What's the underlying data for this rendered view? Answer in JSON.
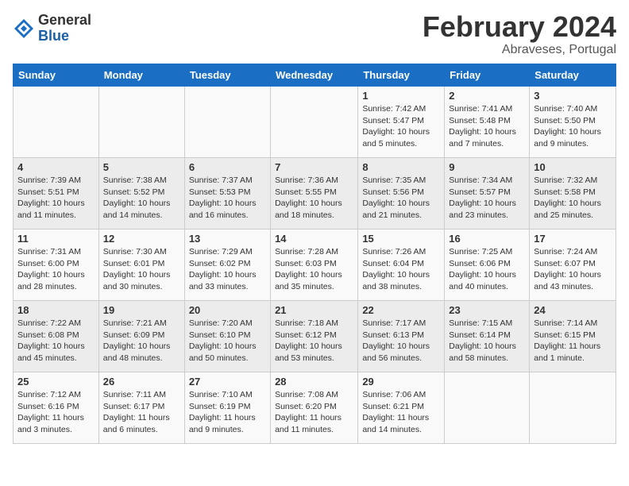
{
  "header": {
    "logo_general": "General",
    "logo_blue": "Blue",
    "month_title": "February 2024",
    "location": "Abraveses, Portugal"
  },
  "days_of_week": [
    "Sunday",
    "Monday",
    "Tuesday",
    "Wednesday",
    "Thursday",
    "Friday",
    "Saturday"
  ],
  "weeks": [
    [
      {
        "day": "",
        "info": ""
      },
      {
        "day": "",
        "info": ""
      },
      {
        "day": "",
        "info": ""
      },
      {
        "day": "",
        "info": ""
      },
      {
        "day": "1",
        "info": "Sunrise: 7:42 AM\nSunset: 5:47 PM\nDaylight: 10 hours\nand 5 minutes."
      },
      {
        "day": "2",
        "info": "Sunrise: 7:41 AM\nSunset: 5:48 PM\nDaylight: 10 hours\nand 7 minutes."
      },
      {
        "day": "3",
        "info": "Sunrise: 7:40 AM\nSunset: 5:50 PM\nDaylight: 10 hours\nand 9 minutes."
      }
    ],
    [
      {
        "day": "4",
        "info": "Sunrise: 7:39 AM\nSunset: 5:51 PM\nDaylight: 10 hours\nand 11 minutes."
      },
      {
        "day": "5",
        "info": "Sunrise: 7:38 AM\nSunset: 5:52 PM\nDaylight: 10 hours\nand 14 minutes."
      },
      {
        "day": "6",
        "info": "Sunrise: 7:37 AM\nSunset: 5:53 PM\nDaylight: 10 hours\nand 16 minutes."
      },
      {
        "day": "7",
        "info": "Sunrise: 7:36 AM\nSunset: 5:55 PM\nDaylight: 10 hours\nand 18 minutes."
      },
      {
        "day": "8",
        "info": "Sunrise: 7:35 AM\nSunset: 5:56 PM\nDaylight: 10 hours\nand 21 minutes."
      },
      {
        "day": "9",
        "info": "Sunrise: 7:34 AM\nSunset: 5:57 PM\nDaylight: 10 hours\nand 23 minutes."
      },
      {
        "day": "10",
        "info": "Sunrise: 7:32 AM\nSunset: 5:58 PM\nDaylight: 10 hours\nand 25 minutes."
      }
    ],
    [
      {
        "day": "11",
        "info": "Sunrise: 7:31 AM\nSunset: 6:00 PM\nDaylight: 10 hours\nand 28 minutes."
      },
      {
        "day": "12",
        "info": "Sunrise: 7:30 AM\nSunset: 6:01 PM\nDaylight: 10 hours\nand 30 minutes."
      },
      {
        "day": "13",
        "info": "Sunrise: 7:29 AM\nSunset: 6:02 PM\nDaylight: 10 hours\nand 33 minutes."
      },
      {
        "day": "14",
        "info": "Sunrise: 7:28 AM\nSunset: 6:03 PM\nDaylight: 10 hours\nand 35 minutes."
      },
      {
        "day": "15",
        "info": "Sunrise: 7:26 AM\nSunset: 6:04 PM\nDaylight: 10 hours\nand 38 minutes."
      },
      {
        "day": "16",
        "info": "Sunrise: 7:25 AM\nSunset: 6:06 PM\nDaylight: 10 hours\nand 40 minutes."
      },
      {
        "day": "17",
        "info": "Sunrise: 7:24 AM\nSunset: 6:07 PM\nDaylight: 10 hours\nand 43 minutes."
      }
    ],
    [
      {
        "day": "18",
        "info": "Sunrise: 7:22 AM\nSunset: 6:08 PM\nDaylight: 10 hours\nand 45 minutes."
      },
      {
        "day": "19",
        "info": "Sunrise: 7:21 AM\nSunset: 6:09 PM\nDaylight: 10 hours\nand 48 minutes."
      },
      {
        "day": "20",
        "info": "Sunrise: 7:20 AM\nSunset: 6:10 PM\nDaylight: 10 hours\nand 50 minutes."
      },
      {
        "day": "21",
        "info": "Sunrise: 7:18 AM\nSunset: 6:12 PM\nDaylight: 10 hours\nand 53 minutes."
      },
      {
        "day": "22",
        "info": "Sunrise: 7:17 AM\nSunset: 6:13 PM\nDaylight: 10 hours\nand 56 minutes."
      },
      {
        "day": "23",
        "info": "Sunrise: 7:15 AM\nSunset: 6:14 PM\nDaylight: 10 hours\nand 58 minutes."
      },
      {
        "day": "24",
        "info": "Sunrise: 7:14 AM\nSunset: 6:15 PM\nDaylight: 11 hours\nand 1 minute."
      }
    ],
    [
      {
        "day": "25",
        "info": "Sunrise: 7:12 AM\nSunset: 6:16 PM\nDaylight: 11 hours\nand 3 minutes."
      },
      {
        "day": "26",
        "info": "Sunrise: 7:11 AM\nSunset: 6:17 PM\nDaylight: 11 hours\nand 6 minutes."
      },
      {
        "day": "27",
        "info": "Sunrise: 7:10 AM\nSunset: 6:19 PM\nDaylight: 11 hours\nand 9 minutes."
      },
      {
        "day": "28",
        "info": "Sunrise: 7:08 AM\nSunset: 6:20 PM\nDaylight: 11 hours\nand 11 minutes."
      },
      {
        "day": "29",
        "info": "Sunrise: 7:06 AM\nSunset: 6:21 PM\nDaylight: 11 hours\nand 14 minutes."
      },
      {
        "day": "",
        "info": ""
      },
      {
        "day": "",
        "info": ""
      }
    ]
  ]
}
